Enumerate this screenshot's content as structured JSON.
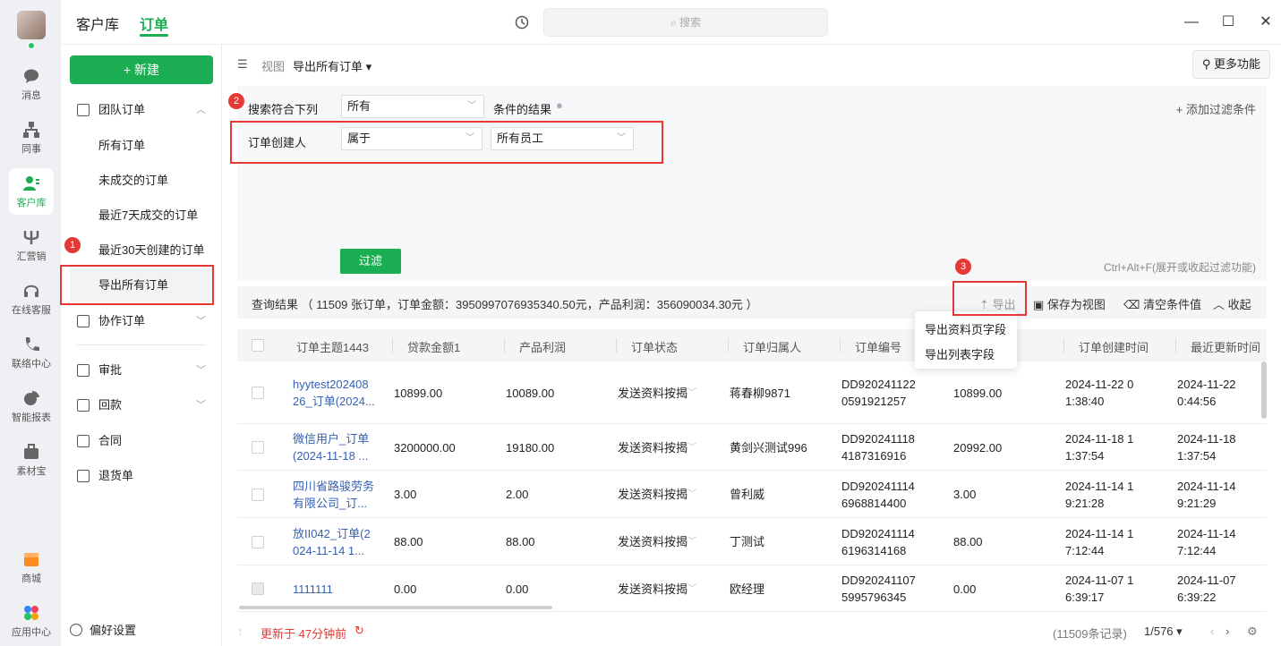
{
  "rail": {
    "items": [
      {
        "label": "消息",
        "icon": "chat-icon"
      },
      {
        "label": "同事",
        "icon": "org-icon"
      },
      {
        "label": "客户库",
        "icon": "customer-icon"
      },
      {
        "label": "汇营销",
        "icon": "marketing-icon"
      },
      {
        "label": "在线客服",
        "icon": "headset-icon"
      },
      {
        "label": "联络中心",
        "icon": "phone-icon"
      },
      {
        "label": "智能报表",
        "icon": "pie-icon"
      },
      {
        "label": "素材宝",
        "icon": "briefcase-icon"
      },
      {
        "label": "商城",
        "icon": "shop-icon"
      },
      {
        "label": "应用中心",
        "icon": "apps-icon"
      }
    ],
    "active_color": "#1aad52"
  },
  "topbar": {
    "tabs": [
      "客户库",
      "订单"
    ],
    "search_placeholder": "搜索"
  },
  "left": {
    "new_label": "+ 新建",
    "team_orders": "团队订单",
    "sub_items": [
      "所有订单",
      "未成交的订单",
      "最近7天成交的订单",
      "最近30天创建的订单",
      "导出所有订单"
    ],
    "collab": "协作订单",
    "approval": "审批",
    "payment": "回款",
    "contract": "合同",
    "returns": "退货单",
    "prefs": "偏好设置"
  },
  "annotations": {
    "b1": "1",
    "b2": "2",
    "b3": "3"
  },
  "viewbar": {
    "view_label": "视图",
    "view_name": "导出所有订单 ▾",
    "more": "更多功能"
  },
  "filters": {
    "search_label": "搜索符合下列",
    "match": "所有",
    "result_label": "条件的结果",
    "add": "+ 添加过滤条件",
    "field": "订单创建人",
    "op": "属于",
    "value": "所有员工",
    "filter_btn": "过滤",
    "hint": "Ctrl+Alt+F(展开或收起过滤功能)"
  },
  "result": {
    "summary": "查询结果 （ 11509 张订单，订单金额：3950997076935340.50元，产品利润：356090034.30元 ）",
    "export": "导出",
    "save_view": "保存为视图",
    "clear": "清空条件值",
    "collapse": "收起"
  },
  "export_menu": [
    "导出资料页字段",
    "导出列表字段"
  ],
  "table": {
    "headers": [
      "订单主题1443",
      "贷款金额1",
      "产品利润",
      "订单状态",
      "订单归属人",
      "订单编号",
      "",
      "订单创建时间",
      "最近更新时间"
    ],
    "rows": [
      {
        "subject": [
          "hyytest202408",
          "26_订单(2024..."
        ],
        "amount": "10899.00",
        "profit": "10089.00",
        "status": "发送资料按揭",
        "owner": "蒋春柳9871",
        "no": [
          "DD920241122",
          "0591921257"
        ],
        "extra": "10899.00",
        "created": [
          "2024-11-22 0",
          "1:38:40"
        ],
        "updated": [
          "2024-11-22",
          "0:44:56"
        ]
      },
      {
        "subject": [
          "微信用户_订单",
          "(2024-11-18 ..."
        ],
        "amount": "3200000.00",
        "profit": "19180.00",
        "status": "发送资料按揭",
        "owner": "黄剑兴测试996",
        "no": [
          "DD920241118",
          "4187316916"
        ],
        "extra": "20992.00",
        "created": [
          "2024-11-18 1",
          "1:37:54"
        ],
        "updated": [
          "2024-11-18",
          "1:37:54"
        ]
      },
      {
        "subject": [
          "四川省路骏劳务",
          "有限公司_订..."
        ],
        "amount": "3.00",
        "profit": "2.00",
        "status": "发送资料按揭",
        "owner": "曾利威",
        "no": [
          "DD920241114",
          "6968814400"
        ],
        "extra": "3.00",
        "created": [
          "2024-11-14 1",
          "9:21:28"
        ],
        "updated": [
          "2024-11-14",
          "9:21:29"
        ]
      },
      {
        "subject": [
          "放II042_订单(2",
          "024-11-14 1..."
        ],
        "amount": "88.00",
        "profit": "88.00",
        "status": "发送资料按揭",
        "owner": "丁测试",
        "no": [
          "DD920241114",
          "6196314168"
        ],
        "extra": "88.00",
        "created": [
          "2024-11-14 1",
          "7:12:44"
        ],
        "updated": [
          "2024-11-14",
          "7:12:44"
        ]
      },
      {
        "subject": [
          "1111111",
          ""
        ],
        "amount": "0.00",
        "profit": "0.00",
        "status": "发送资料按揭",
        "owner": "欧经理",
        "no": [
          "DD920241107",
          "5995796345"
        ],
        "extra": "0.00",
        "created": [
          "2024-11-07 1",
          "6:39:17"
        ],
        "updated": [
          "2024-11-07",
          "6:39:22"
        ]
      }
    ]
  },
  "footer": {
    "updated": "更新于  47分钟前",
    "records": "(11509条记录)",
    "page": "1/576 ▾"
  }
}
